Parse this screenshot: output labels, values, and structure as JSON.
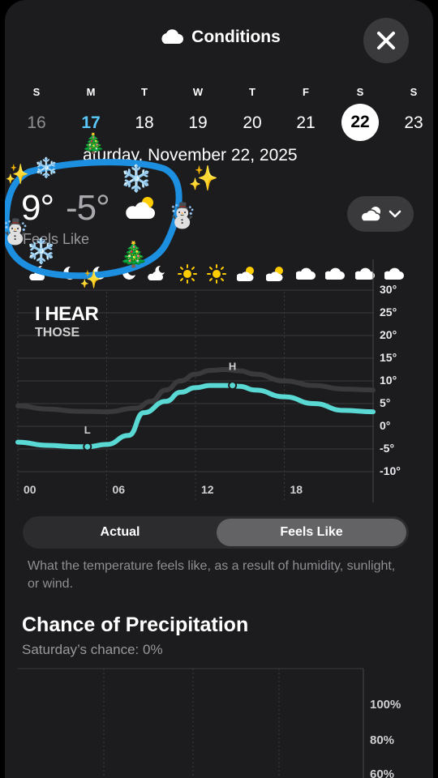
{
  "header": {
    "title": "Conditions",
    "close_icon": "close-icon",
    "title_icon": "cloud-icon"
  },
  "days": [
    {
      "dow": "S",
      "date": "16",
      "state": "past"
    },
    {
      "dow": "M",
      "date": "17",
      "state": "today"
    },
    {
      "dow": "T",
      "date": "18",
      "state": "normal"
    },
    {
      "dow": "W",
      "date": "19",
      "state": "normal"
    },
    {
      "dow": "T",
      "date": "20",
      "state": "normal"
    },
    {
      "dow": "F",
      "date": "21",
      "state": "normal"
    },
    {
      "dow": "S",
      "date": "22",
      "state": "selected"
    },
    {
      "dow": "S",
      "date": "23",
      "state": "normal"
    }
  ],
  "selected_date_text": "aturday, November 22, 2025",
  "temps": {
    "high": "9°",
    "low": "-5°",
    "feels_like_label": "Feels Like"
  },
  "condition_selector": {
    "icon": "partly-cloudy-icon",
    "chevron": "chevron-down-icon"
  },
  "overlay_text": {
    "line1": "I HEAR",
    "line2": "THOSE"
  },
  "hourly_icons": [
    "moon-cloud",
    "moon",
    "moon",
    "moon",
    "moon-cloud",
    "sun",
    "sun",
    "sun-cloud",
    "sun-cloud",
    "cloud",
    "cloud",
    "cloud",
    "cloud"
  ],
  "temp_chart": {
    "chart_data": {
      "type": "line",
      "x_ticks": [
        "00",
        "06",
        "12",
        "18"
      ],
      "y_ticks": [
        "30°",
        "25°",
        "20°",
        "15°",
        "10°",
        "5°",
        "0°",
        "-5°",
        "-10°"
      ],
      "ylim": [
        -10,
        30
      ],
      "xlim": [
        0,
        24
      ],
      "series": [
        {
          "name": "Actual",
          "color": "#3a3a3c",
          "x": [
            0,
            2,
            4,
            6,
            8,
            9,
            10,
            11,
            12,
            13,
            14,
            15,
            16,
            18,
            20,
            22,
            24
          ],
          "y": [
            4.5,
            3.8,
            3.3,
            3.2,
            4,
            5.5,
            8,
            10,
            11.5,
            12.3,
            12.5,
            12.2,
            11.5,
            10,
            9,
            8.2,
            8
          ]
        },
        {
          "name": "Feels Like",
          "color": "#5ad8d4",
          "x": [
            0,
            2,
            4,
            4.7,
            6,
            7.5,
            8.5,
            10,
            11,
            12,
            13,
            14,
            15,
            16,
            18,
            20,
            22,
            24
          ],
          "y": [
            -3.5,
            -4.2,
            -4.5,
            -4.5,
            -4,
            -2,
            3,
            5.5,
            7.5,
            8.5,
            9,
            9,
            8.8,
            8,
            6.5,
            5,
            3.5,
            3.2
          ]
        }
      ],
      "annotations": [
        {
          "label": "L",
          "x": 4.7,
          "y": -4.5
        },
        {
          "label": "H",
          "x": 14.5,
          "y": 9
        }
      ]
    }
  },
  "segmented": {
    "actual": "Actual",
    "feels_like": "Feels Like",
    "selected": "Feels Like"
  },
  "explanation": "What the temperature feels like, as a result of humidity, sunlight, or wind.",
  "precipitation": {
    "title": "Chance of Precipitation",
    "subtitle": "Saturday’s chance: 0%",
    "y_ticks": [
      "100%",
      "80%",
      "60%"
    ]
  }
}
